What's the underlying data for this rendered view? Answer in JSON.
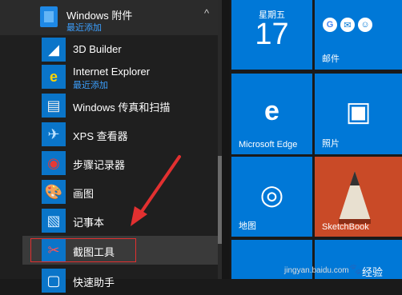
{
  "start_menu": {
    "group": {
      "title": "Windows 附件",
      "subtitle": "最近添加",
      "chevron": "^"
    },
    "items": [
      {
        "label": "3D Builder",
        "icon": "3d-builder-icon"
      },
      {
        "label": "Internet Explorer",
        "sub": "最近添加",
        "icon": "internet-explorer-icon"
      },
      {
        "label": "Windows 传真和扫描",
        "icon": "fax-scan-icon"
      },
      {
        "label": "XPS 查看器",
        "icon": "xps-viewer-icon"
      },
      {
        "label": "步骤记录器",
        "icon": "steps-recorder-icon"
      },
      {
        "label": "画图",
        "icon": "paint-icon"
      },
      {
        "label": "记事本",
        "icon": "notepad-icon"
      },
      {
        "label": "截图工具",
        "icon": "snipping-tool-icon"
      },
      {
        "label": "快速助手",
        "icon": "quick-assist-icon"
      }
    ]
  },
  "tiles": {
    "calendar": {
      "day": "星期五",
      "date": "17"
    },
    "mail": {
      "label": "邮件"
    },
    "edge": {
      "label": "Microsoft Edge"
    },
    "photos": {
      "label": "照片"
    },
    "maps": {
      "label": "地图"
    },
    "sketchbook": {
      "label": "SketchBook"
    }
  },
  "watermark": {
    "url": "jingyan.baidu.com",
    "brand": "经验"
  },
  "colors": {
    "accent": "#0078d7",
    "link": "#3ca0ff",
    "highlight_box": "#e23030",
    "arrow": "#e23030"
  }
}
